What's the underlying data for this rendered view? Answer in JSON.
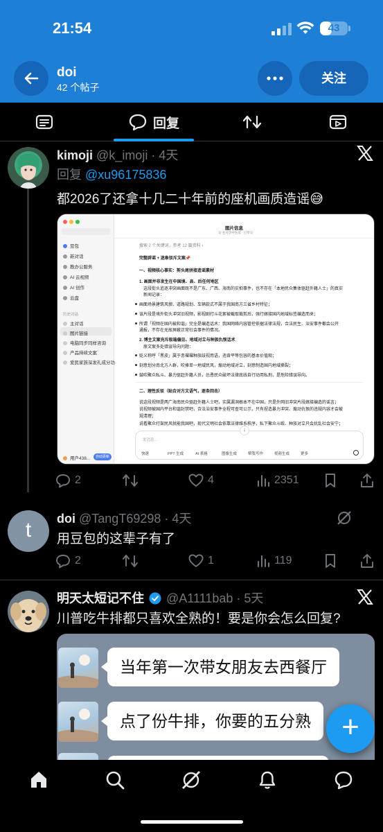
{
  "status_bar": {
    "time": "21:54",
    "battery": "43",
    "battery_level": 0.43
  },
  "header": {
    "title": "doi",
    "subtitle": "42 个帖子",
    "follow_label": "关注"
  },
  "tabs": [
    {
      "name": "posts",
      "label": ""
    },
    {
      "name": "replies",
      "label": "回复",
      "active": true
    },
    {
      "name": "reposts",
      "label": ""
    },
    {
      "name": "media",
      "label": ""
    }
  ],
  "tweets": [
    {
      "name": "kimoji",
      "handle": "@k_imoji · 4天",
      "reply_prefix": "回复 ",
      "reply_to": "@xu96175836",
      "text": "都2026了还拿十几二十年前的座机画质造谣😅",
      "stats": {
        "replies": "2",
        "reposts": "",
        "likes": "4",
        "views": "2351"
      }
    },
    {
      "name": "doi",
      "avatar_letter": "t",
      "handle": "@TangT69298 · 4天",
      "text": "用豆包的这辈子有了",
      "stats": {
        "replies": "2",
        "reposts": "",
        "likes": "1",
        "views": "119"
      }
    },
    {
      "name": "明天太短记不住",
      "handle": "@A1111bab · 5天",
      "text": "川普吃牛排都只喜欢全熟的！要是你会怎么回复?",
      "stats": {}
    }
  ],
  "screenshot": {
    "sidebar": [
      "豆包",
      "新对话",
      "教办公服务",
      "AI 云视频",
      "AI 创作",
      "云盘",
      "历史对话",
      "主对话",
      "图片链接",
      "电脑同步同样咨询",
      "产品持续文案",
      "爱民家族深发礼成分功"
    ],
    "sidebar_user": "用户438...",
    "sidebar_new": "自动更新",
    "title": "图片信息",
    "title_sub": "与 主对话中生成 · 已参与",
    "search_note": "搜索 2 个关键词，参考 12 篇资料 ›",
    "lines": [
      "完整辟谣 + 迷象驳斥文案📌",
      "一、视频核心事实：剪头尾拼接造谣素材",
      "1. 画面并非发生在中国境、县、后任何地区",
      "这段街头追逐冲突画面既不是广东、广西、海南的实拍事件，也不存在「本地民众集体驱赶外籍人士」的真实",
      "新闻记录：",
      "画面场景建筑风貌、道路规划、车辆款式不属于我国南方三省乡村特征；",
      "该片段是境外街头冲突旧视频，影视剧打斗花絮被截取裁剪后，强行嫁接国内地域标签编造而来；",
      "所谓「视频在国内被和谐」完全是编造话术：我国网络内容管控依据法律法规，合法民生、治安事件都会公开",
      "通报，不存在无故屏蔽正常社会事件的情况。",
      "2. 博主文案充斥极端偏见、地域对立与种族仇恨话术",
      "原文案多处错误导向问题：",
      "贬义称呼「黑皮」属于赤裸裸种族歧视用语，违背平等包容的基本价值观；",
      "刻意划分南北方人群，吹捧单一地域民风，煽动地域对立，刻意制造国内地域撕裂；",
      "鼓吹聚众私斗、暴力驱赶外籍人员，怂恿民众破坏法律底线自行动用私刑，是危险错误导向。",
      "二、理性反驳（贴合对方文语气，逐条回击）",
      "说这段视频是两广海南民众驱赶外籍人士吧，实属漏洞根本不在中国，只是外网旧冲突片段嫁接编造的谣言；",
      "说视频被国内平台和谐封禁吧，合法治安事件全程可查可公示，只有捏造暴力冲突、煽动仇恨的违规内容才会被",
      "规清理；",
      "说看聚众打架民风就能我国吧，现代文明社会依靠法律维系秩序，私下聚众斗殴、种族对立只会扰乱社会安宁；"
    ],
    "input_placeholder": "发消息...",
    "chips": [
      "快速",
      "PPT 生成",
      "AI 表格",
      "图像生成",
      "帮我写作",
      "视频生成",
      "更多"
    ]
  },
  "chat": {
    "messages": [
      "当年第一次带女朋友去西餐厅",
      "点了份牛排，你要的五分熟"
    ]
  },
  "colors": {
    "accent": "#1d9bf0",
    "header_bg": "#1d7fd6",
    "bg": "#000000"
  },
  "icons": {
    "nav": [
      "home-icon",
      "search-icon",
      "grok-icon",
      "notifications-icon",
      "messages-icon"
    ],
    "fab": "+"
  }
}
